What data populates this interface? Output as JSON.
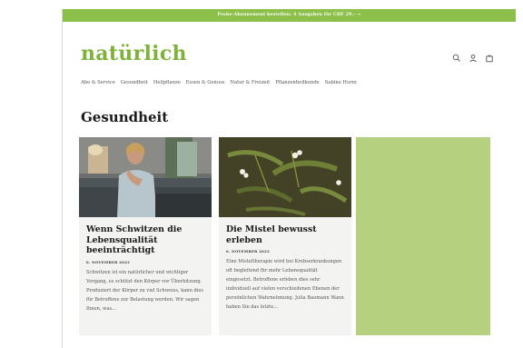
{
  "announcement": "Probe-Abonnement bestellen: 4 Ausgaben für CHF 29.– →",
  "logo": "natürlich",
  "nav": [
    "Abo & Service",
    "Gesundheit",
    "Heilpflanze",
    "Essen & Genuss",
    "Natur & Freizeit",
    "Pflanzenheilkunde",
    "Sabine Hurni"
  ],
  "icons": [
    "search-icon",
    "user-icon",
    "cart-icon"
  ],
  "page_title": "Gesundheit",
  "articles": [
    {
      "title": "Wenn Schwitzen die Lebensqualität beeinträchtigt",
      "date": "6. NOVEMBER 2023",
      "excerpt": "Schwitzen ist ein natürlicher und wichtiger Vorgang, es schützt den Körper vor Überhitzung. Produziert der Körper zu viel Schweiss, kann dies für Betroffene zur Belastung werden. Wir sagen Ihnen, was..."
    },
    {
      "title": "Die Mistel bewusst erleben",
      "date": "6. NOVEMBER 2023",
      "excerpt": "Eine Misteltherapie wird bei Krebserkrankungen oft begleitend für mehr Lebensqualität eingesetzt. Betroffene erleben dies sehr individuell auf vielen verschiedenen Ebenen der persönlichen Wahrnehmung. Julia Baumann Wann haben Sie das letzte..."
    }
  ],
  "colors": {
    "accent": "#8cc04a",
    "logo": "#7fb23a",
    "panel": "#b5d17f"
  }
}
